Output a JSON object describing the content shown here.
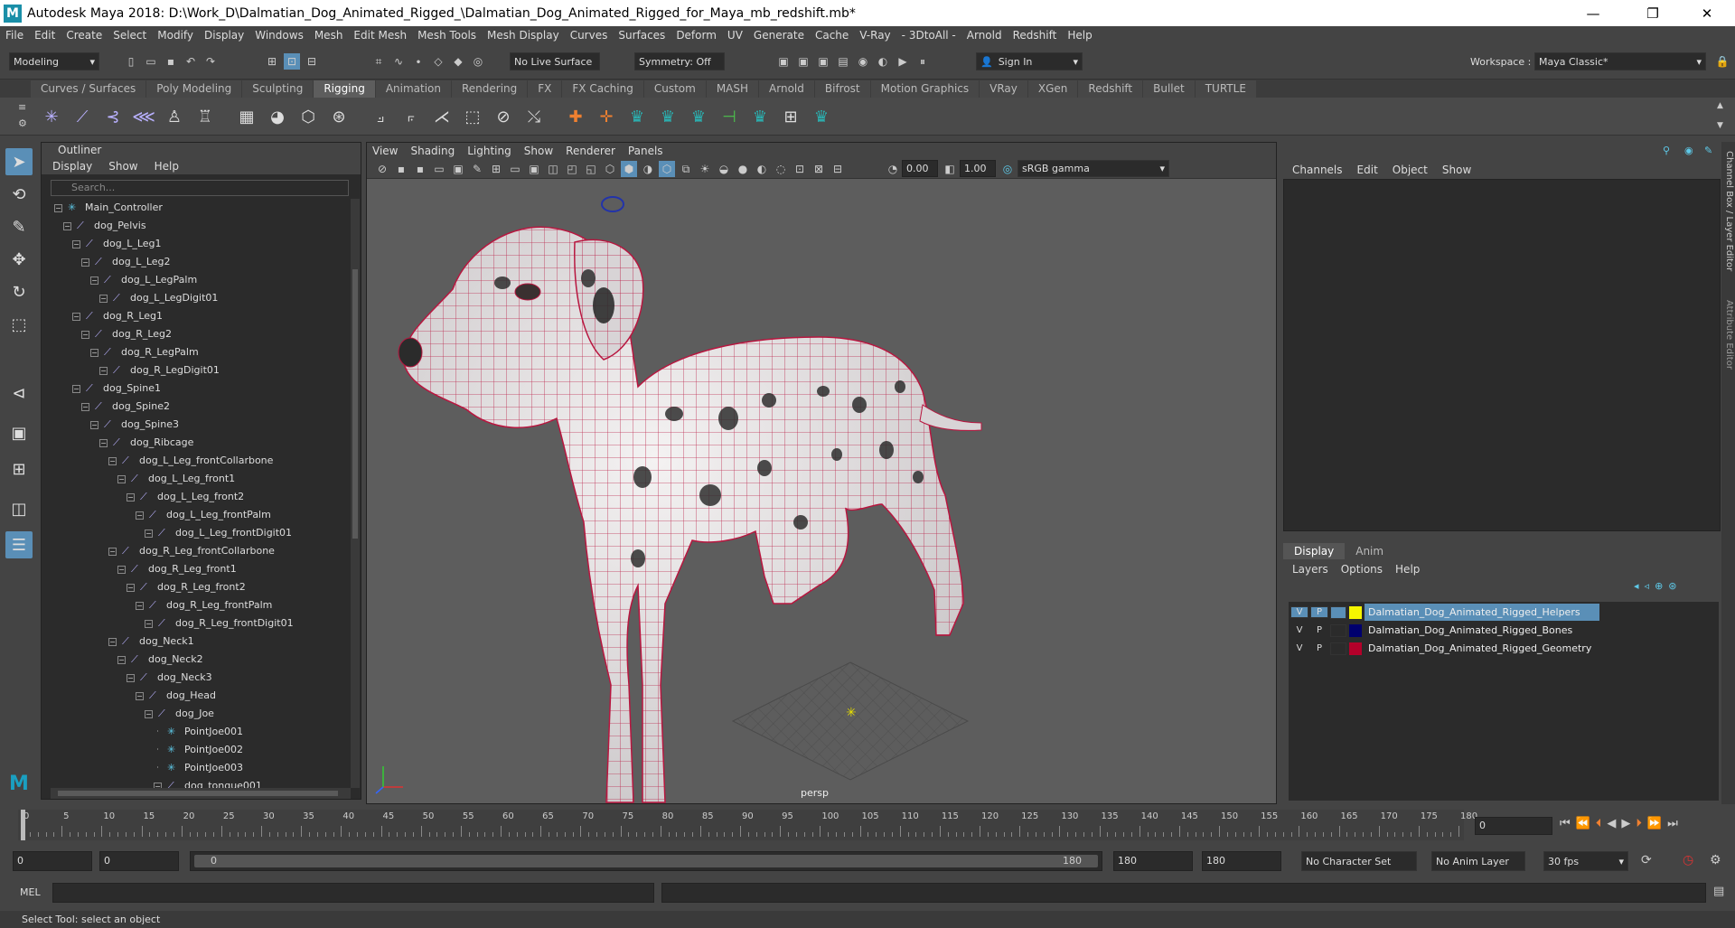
{
  "window": {
    "title": "Autodesk Maya 2018: D:\\Work_D\\Dalmatian_Dog_Animated_Rigged_\\Dalmatian_Dog_Animated_Rigged_for_Maya_mb_redshift.mb*"
  },
  "menubar": [
    "File",
    "Edit",
    "Create",
    "Select",
    "Modify",
    "Display",
    "Windows",
    "Mesh",
    "Edit Mesh",
    "Mesh Tools",
    "Mesh Display",
    "Curves",
    "Surfaces",
    "Deform",
    "UV",
    "Generate",
    "Cache",
    "V-Ray",
    "- 3DtoAll -",
    "Arnold",
    "Redshift",
    "Help"
  ],
  "status": {
    "mode": "Modeling",
    "live_surface": "No Live Surface",
    "symmetry": "Symmetry: Off",
    "sign_in": "Sign In",
    "workspace_label": "Workspace :",
    "workspace": "Maya Classic*"
  },
  "shelf_tabs": [
    "Curves / Surfaces",
    "Poly Modeling",
    "Sculpting",
    "Rigging",
    "Animation",
    "Rendering",
    "FX",
    "FX Caching",
    "Custom",
    "MASH",
    "Arnold",
    "Bifrost",
    "Motion Graphics",
    "VRay",
    "XGen",
    "Redshift",
    "Bullet",
    "TURTLE"
  ],
  "active_shelf": "Rigging",
  "outliner": {
    "title": "Outliner",
    "menu": [
      "Display",
      "Show",
      "Help"
    ],
    "search_placeholder": "Search...",
    "rows": [
      {
        "name": "Main_Controller",
        "depth": 0,
        "icon": "locator"
      },
      {
        "name": "dog_Pelvis",
        "depth": 1,
        "icon": "joint"
      },
      {
        "name": "dog_L_Leg1",
        "depth": 2,
        "icon": "joint"
      },
      {
        "name": "dog_L_Leg2",
        "depth": 3,
        "icon": "joint"
      },
      {
        "name": "dog_L_LegPalm",
        "depth": 4,
        "icon": "joint"
      },
      {
        "name": "dog_L_LegDigit01",
        "depth": 5,
        "icon": "joint"
      },
      {
        "name": "dog_R_Leg1",
        "depth": 2,
        "icon": "joint"
      },
      {
        "name": "dog_R_Leg2",
        "depth": 3,
        "icon": "joint"
      },
      {
        "name": "dog_R_LegPalm",
        "depth": 4,
        "icon": "joint"
      },
      {
        "name": "dog_R_LegDigit01",
        "depth": 5,
        "icon": "joint"
      },
      {
        "name": "dog_Spine1",
        "depth": 2,
        "icon": "joint"
      },
      {
        "name": "dog_Spine2",
        "depth": 3,
        "icon": "joint"
      },
      {
        "name": "dog_Spine3",
        "depth": 4,
        "icon": "joint"
      },
      {
        "name": "dog_Ribcage",
        "depth": 5,
        "icon": "joint"
      },
      {
        "name": "dog_L_Leg_frontCollarbone",
        "depth": 6,
        "icon": "joint"
      },
      {
        "name": "dog_L_Leg_front1",
        "depth": 7,
        "icon": "joint"
      },
      {
        "name": "dog_L_Leg_front2",
        "depth": 8,
        "icon": "joint"
      },
      {
        "name": "dog_L_Leg_frontPalm",
        "depth": 9,
        "icon": "joint"
      },
      {
        "name": "dog_L_Leg_frontDigit01",
        "depth": 10,
        "icon": "joint"
      },
      {
        "name": "dog_R_Leg_frontCollarbone",
        "depth": 6,
        "icon": "joint"
      },
      {
        "name": "dog_R_Leg_front1",
        "depth": 7,
        "icon": "joint"
      },
      {
        "name": "dog_R_Leg_front2",
        "depth": 8,
        "icon": "joint"
      },
      {
        "name": "dog_R_Leg_frontPalm",
        "depth": 9,
        "icon": "joint"
      },
      {
        "name": "dog_R_Leg_frontDigit01",
        "depth": 10,
        "icon": "joint"
      },
      {
        "name": "dog_Neck1",
        "depth": 6,
        "icon": "joint"
      },
      {
        "name": "dog_Neck2",
        "depth": 7,
        "icon": "joint"
      },
      {
        "name": "dog_Neck3",
        "depth": 8,
        "icon": "joint"
      },
      {
        "name": "dog_Head",
        "depth": 9,
        "icon": "joint"
      },
      {
        "name": "dog_Joe",
        "depth": 10,
        "icon": "joint"
      },
      {
        "name": "PointJoe001",
        "depth": 11,
        "icon": "locator"
      },
      {
        "name": "PointJoe002",
        "depth": 11,
        "icon": "locator"
      },
      {
        "name": "PointJoe003",
        "depth": 11,
        "icon": "locator"
      },
      {
        "name": "dog_tongue001",
        "depth": 11,
        "icon": "joint"
      }
    ]
  },
  "viewport": {
    "menu": [
      "View",
      "Shading",
      "Lighting",
      "Show",
      "Renderer",
      "Panels"
    ],
    "near": "0.00",
    "far": "1.00",
    "color_space": "sRGB gamma",
    "camera": "persp"
  },
  "channel_box": {
    "menu": [
      "Channels",
      "Edit",
      "Object",
      "Show"
    ],
    "side_tab_1": "Channel Box / Layer Editor",
    "side_tab_2": "Attribute Editor"
  },
  "layer_editor": {
    "tabs": [
      "Display",
      "Anim"
    ],
    "menu": [
      "Layers",
      "Options",
      "Help"
    ],
    "layers": [
      {
        "v": "V",
        "p": "P",
        "name": "Dalmatian_Dog_Animated_Rigged_Helpers",
        "color": "#f5f500",
        "selected": true
      },
      {
        "v": "V",
        "p": "P",
        "name": "Dalmatian_Dog_Animated_Rigged_Bones",
        "color": "#00006e",
        "selected": false
      },
      {
        "v": "V",
        "p": "P",
        "name": "Dalmatian_Dog_Animated_Rigged_Geometry",
        "color": "#b4002a",
        "selected": false
      }
    ]
  },
  "timeline": {
    "ticks": [
      "0",
      "5",
      "10",
      "15",
      "20",
      "25",
      "30",
      "35",
      "40",
      "45",
      "50",
      "55",
      "60",
      "65",
      "70",
      "75",
      "80",
      "85",
      "90",
      "95",
      "100",
      "105",
      "110",
      "115",
      "120",
      "125",
      "130",
      "135",
      "140",
      "145",
      "150",
      "155",
      "160",
      "165",
      "170",
      "175",
      "180"
    ],
    "current_frame": "0"
  },
  "range": {
    "start": "0",
    "anim_start": "0",
    "range_start": "0",
    "range_end": "180",
    "end": "180",
    "anim_end": "180",
    "character_set": "No Character Set",
    "anim_layer": "No Anim Layer",
    "fps": "30 fps"
  },
  "cmdline": {
    "label": "MEL"
  },
  "help": {
    "text": "Select Tool: select an object"
  }
}
